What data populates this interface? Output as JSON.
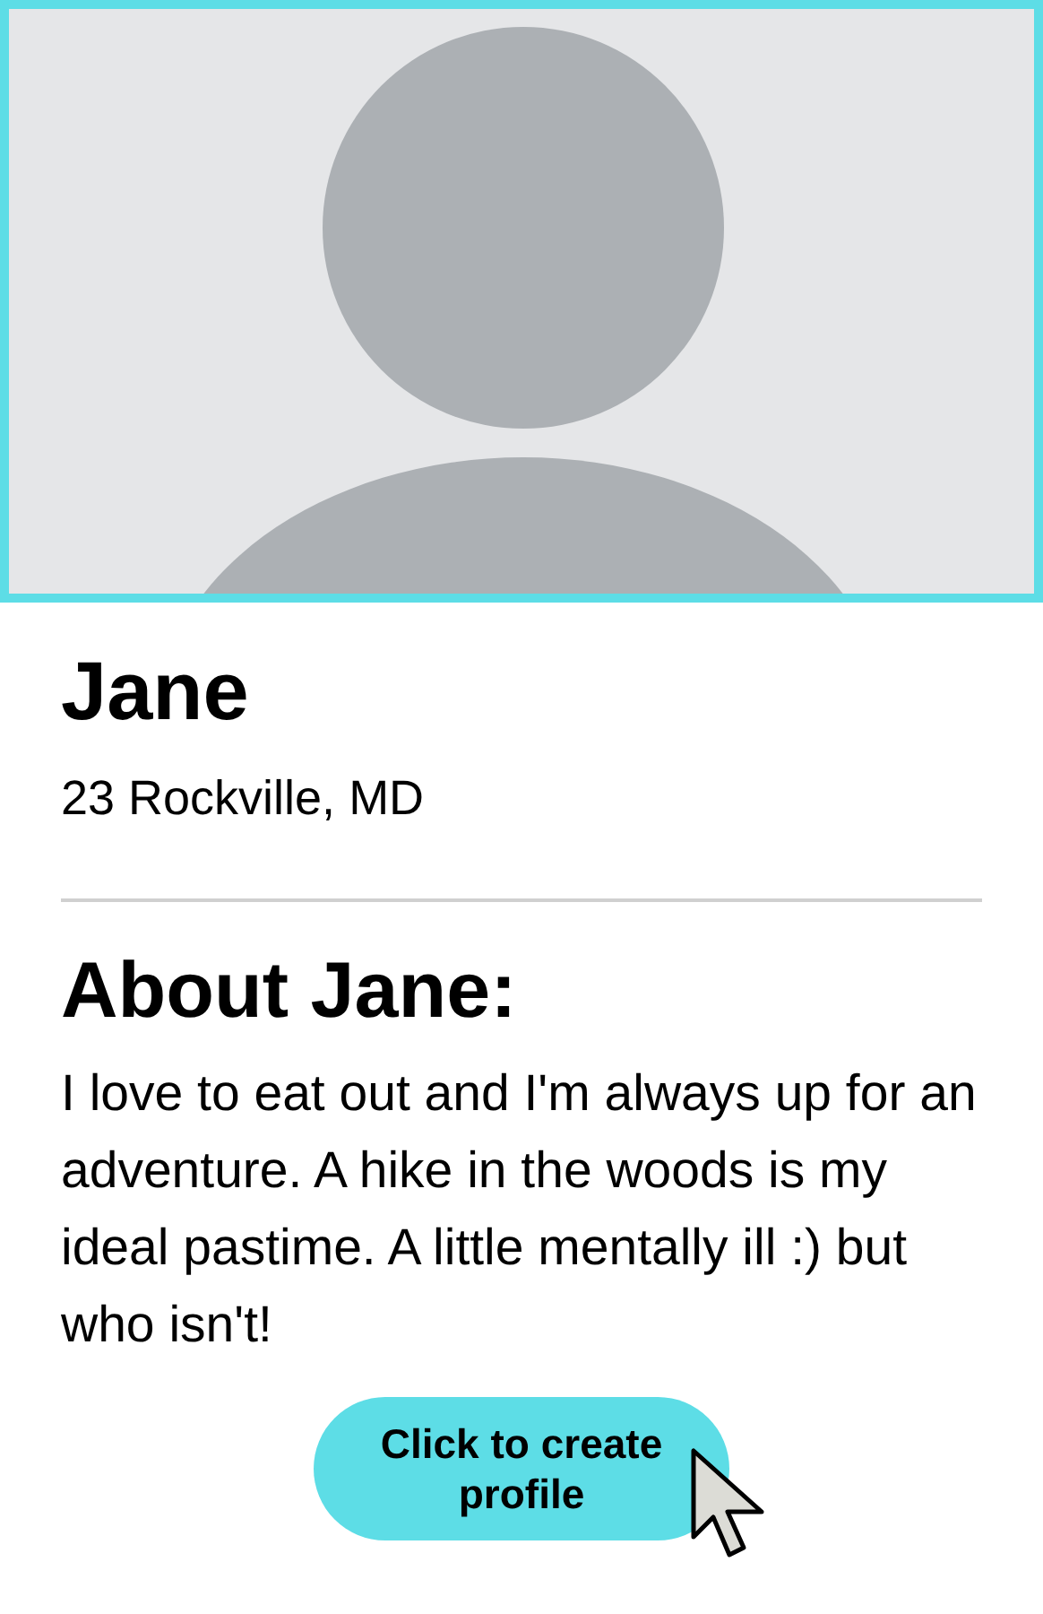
{
  "profile": {
    "name": "Jane",
    "location": "23 Rockville, MD"
  },
  "about": {
    "heading": "About Jane:",
    "text": "I love to eat out and I'm always up for an adventure. A hike in the woods is my ideal pastime. A little mentally ill :) but who isn't!"
  },
  "button": {
    "label": "Click to create profile"
  }
}
